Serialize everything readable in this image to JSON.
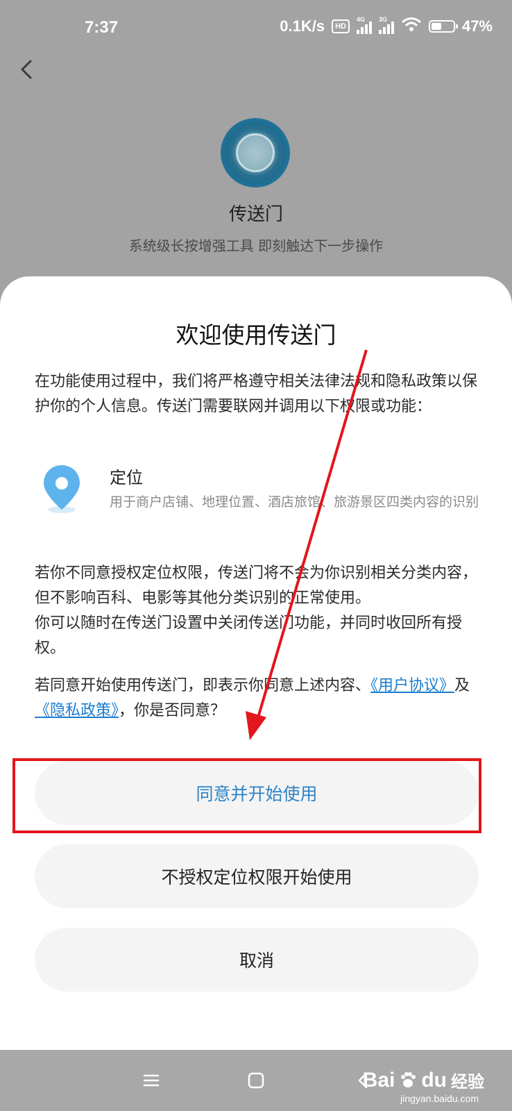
{
  "status_bar": {
    "time": "7:37",
    "net_speed": "0.1K/s",
    "hd": "HD",
    "sim1": "4G",
    "sim2": "3G",
    "battery": "47%",
    "battery_level": 0.47
  },
  "header": {
    "app_name": "传送门",
    "app_desc": "系统级长按增强工具 即刻触达下一步操作"
  },
  "dialog": {
    "title": "欢迎使用传送门",
    "intro": "在功能使用过程中，我们将严格遵守相关法律法规和隐私政策以保护你的个人信息。传送门需要联网并调用以下权限或功能：",
    "permission": {
      "title": "定位",
      "desc": "用于商户店铺、地理位置、酒店旅馆、旅游景区四类内容的识别"
    },
    "warn_1": "若你不同意授权定位权限，传送门将不会为你识别相关分类内容，但不影响百科、电影等其他分类识别的正常使用。",
    "warn_2": "你可以随时在传送门设置中关闭传送门功能，并同时收回所有授权。",
    "consent_prefix": "若同意开始使用传送门，即表示你同意上述内容、",
    "link_user_agreement": "《用户协议》",
    "consent_and": "及",
    "link_privacy_policy": "《隐私政策》",
    "consent_suffix": "，你是否同意？",
    "btn_agree": "同意并开始使用",
    "btn_no_location": "不授权定位权限开始使用",
    "btn_cancel": "取消"
  },
  "watermark": {
    "brand": "Bai",
    "brand_end": "du",
    "word": "经验",
    "url": "jingyan.baidu.com"
  },
  "colors": {
    "accent": "#2d83c6",
    "link": "#1a7cd0",
    "annotation": "#e2161c"
  }
}
